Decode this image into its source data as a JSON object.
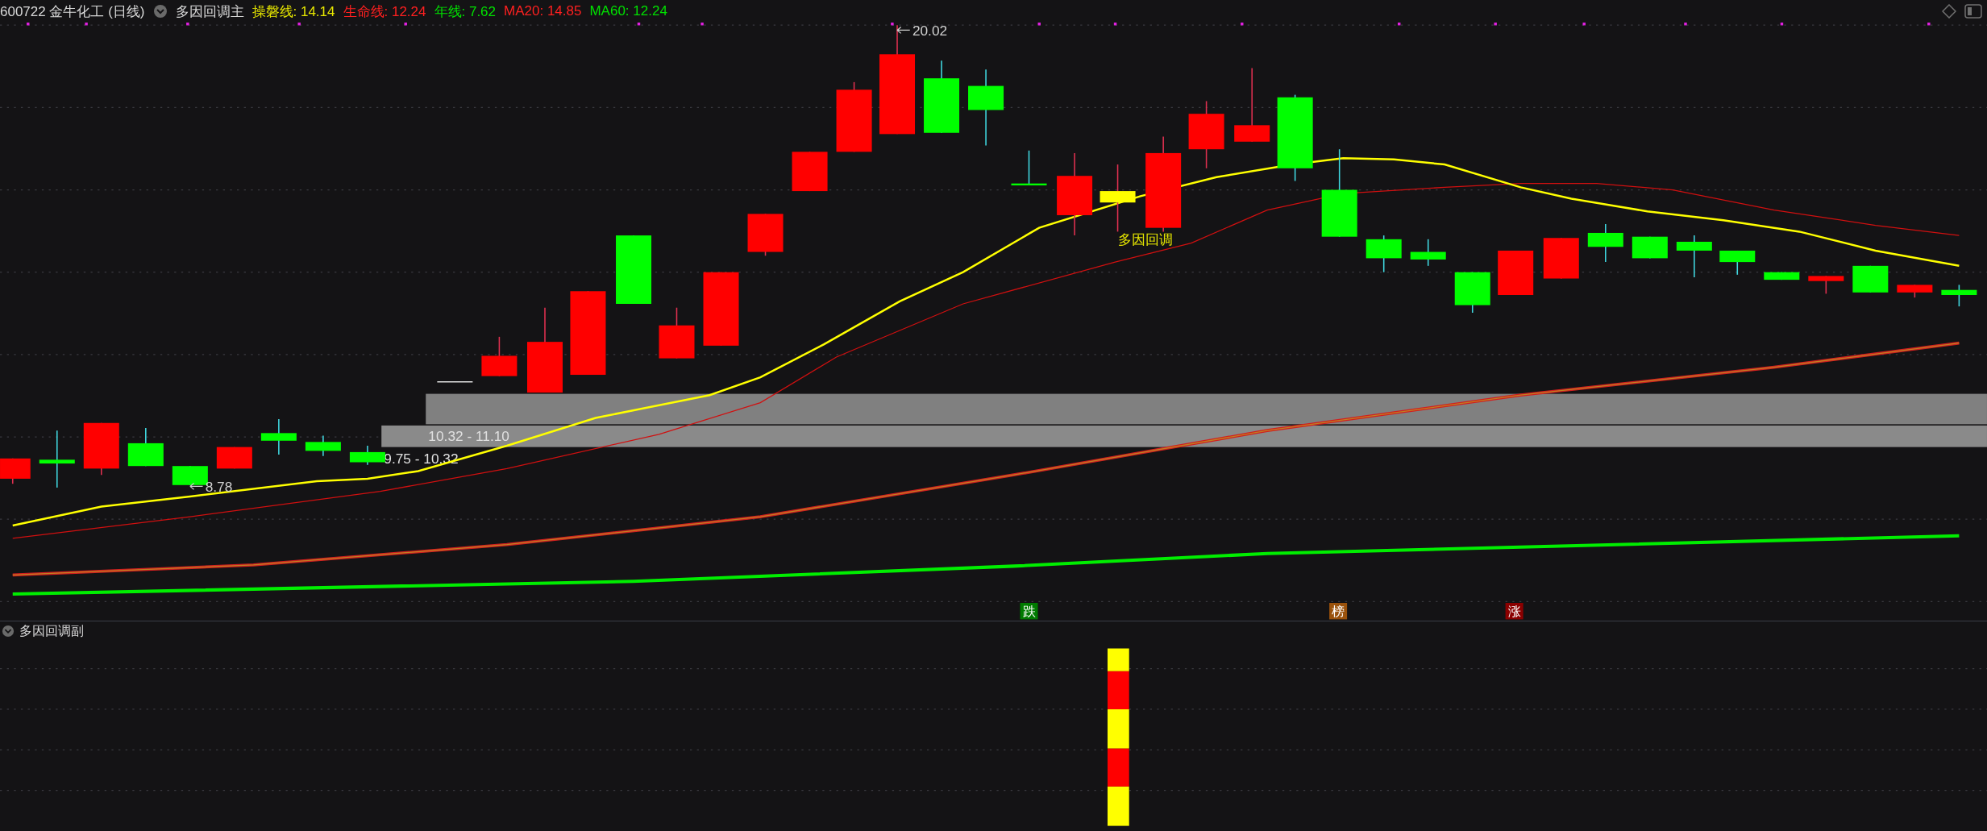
{
  "header": {
    "symbol": "600722 金牛化工 (日线)",
    "indicator": "多因回调主",
    "values": [
      {
        "label": "操磐线: 14.14",
        "color": "#e6e600"
      },
      {
        "label": "生命线: 12.24",
        "color": "#ff2020"
      },
      {
        "label": "年线: 7.62",
        "color": "#00e000"
      },
      {
        "label": "MA20: 14.85",
        "color": "#ff2020"
      },
      {
        "label": "MA60: 12.24",
        "color": "#00e000"
      }
    ]
  },
  "main_chart": {
    "annotations": [
      {
        "kind": "high",
        "text": "20.02"
      },
      {
        "kind": "low",
        "text": "8.78"
      },
      {
        "kind": "signal",
        "text": "多因回调"
      }
    ],
    "zones": [
      {
        "text": "10.32 - 11.10"
      },
      {
        "text": "9.75 - 10.32"
      }
    ],
    "markers": [
      {
        "text": "跌",
        "color": "#007a00"
      },
      {
        "text": "榜",
        "color": "#9a520c"
      },
      {
        "text": "涨",
        "color": "#8b0000"
      }
    ]
  },
  "sub_panel": {
    "title": "多因回调副"
  }
}
